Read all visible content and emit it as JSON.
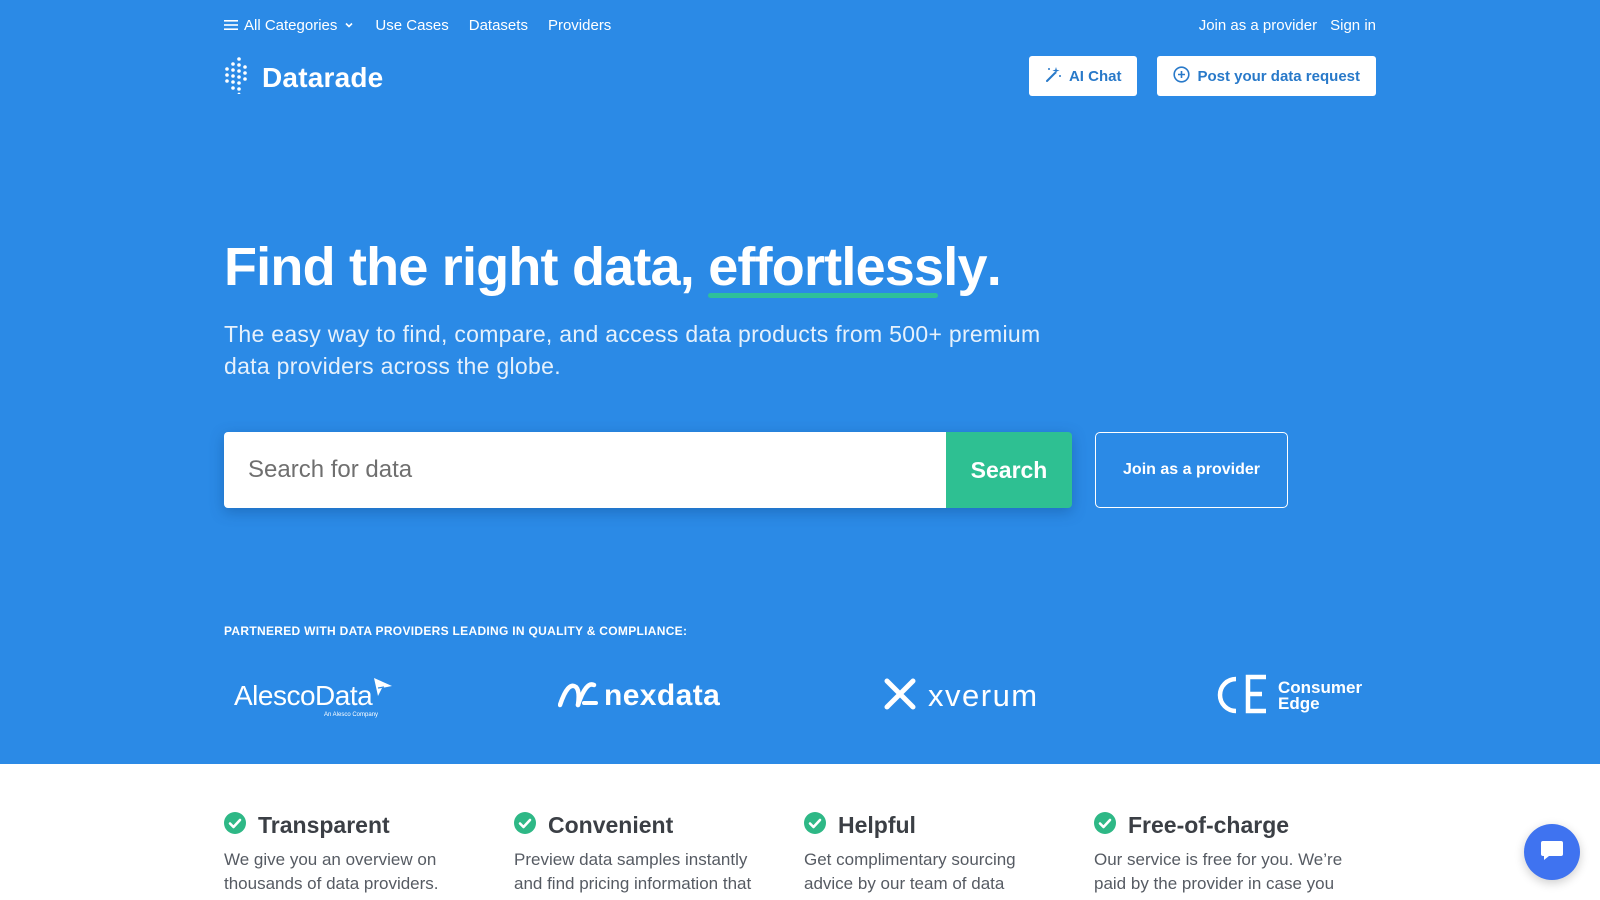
{
  "nav": {
    "all_categories": "All Categories",
    "use_cases": "Use Cases",
    "datasets": "Datasets",
    "providers": "Providers",
    "join_provider": "Join as a provider",
    "sign_in": "Sign in"
  },
  "brand": {
    "name": "Datarade"
  },
  "header_buttons": {
    "ai_chat": "AI Chat",
    "post_request": "Post your data request"
  },
  "hero": {
    "headline_prefix": "Find the right data, ",
    "headline_accent": "effortlessly",
    "headline_suffix": ".",
    "subtitle": "The easy way to find, compare, and access data products from 500+ premium data providers across the globe."
  },
  "search": {
    "placeholder": "Search for data",
    "button": "Search",
    "join_button": "Join as a provider"
  },
  "partners": {
    "label": "PARTNERED WITH DATA PROVIDERS LEADING IN QUALITY & COMPLIANCE:",
    "alesco": "AlescoData",
    "alesco_sub": "An Alesco Company",
    "nexdata": "nexdata",
    "xverum": "xverum",
    "consumer_edge": "Consumer Edge"
  },
  "features": [
    {
      "title": "Transparent",
      "desc": "We give you an overview on thousands of data providers."
    },
    {
      "title": "Convenient",
      "desc": "Preview data samples instantly and find pricing information that"
    },
    {
      "title": "Helpful",
      "desc": "Get complimentary sourcing advice by our team of data"
    },
    {
      "title": "Free-of-charge",
      "desc": "Our service is free for you. We’re paid by the provider in case you"
    }
  ],
  "colors": {
    "hero_bg": "#2b8ae6",
    "search_green": "#2ec092",
    "accent_underline": "#2ec09a",
    "check_green": "#2eb886",
    "chat_blue": "#3f73f0"
  }
}
